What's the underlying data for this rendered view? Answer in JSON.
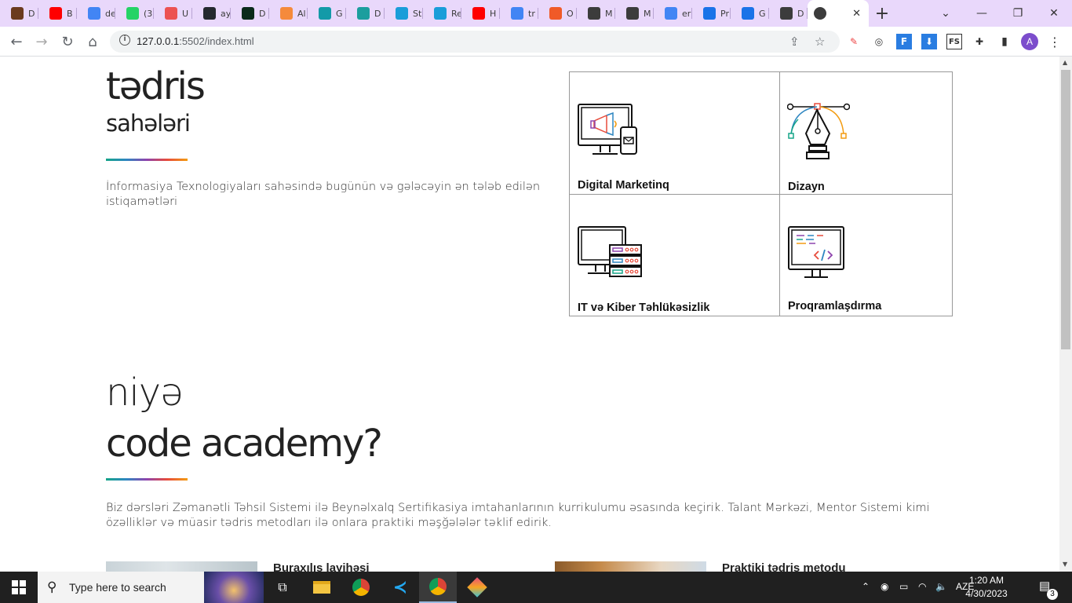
{
  "browser": {
    "tabs": [
      {
        "title": "D",
        "color": "#6b3a1e",
        "icon": "dark-favicon"
      },
      {
        "title": "B",
        "color": "#ff0000",
        "icon": "youtube-icon"
      },
      {
        "title": "de",
        "color": "#4285f4",
        "icon": "google-icon"
      },
      {
        "title": "(3",
        "color": "#25d366",
        "icon": "whatsapp-icon"
      },
      {
        "title": "U",
        "color": "#ec5252",
        "icon": "udemy-icon"
      },
      {
        "title": "ay",
        "color": "#24292e",
        "icon": "github-icon"
      },
      {
        "title": "D",
        "color": "#0a2a1a",
        "icon": "mongodb-icon"
      },
      {
        "title": "Al",
        "color": "#f58a3c",
        "icon": "heart-icon"
      },
      {
        "title": "G",
        "color": "#139aa8",
        "icon": "diamond-icon"
      },
      {
        "title": "D",
        "color": "#1c9e9e",
        "icon": "diamond-x-icon"
      },
      {
        "title": "St",
        "color": "#1a9dd9",
        "icon": "figma-dots-icon"
      },
      {
        "title": "Re",
        "color": "#1a9dd9",
        "icon": "figma-dots-icon"
      },
      {
        "title": "H",
        "color": "#ff0000",
        "icon": "youtube-icon"
      },
      {
        "title": "tr",
        "color": "#4285f4",
        "icon": "google-icon"
      },
      {
        "title": "O",
        "color": "#f05a28",
        "icon": "all-icon"
      },
      {
        "title": "M",
        "color": "#3c3c3c",
        "icon": "globe-icon"
      },
      {
        "title": "M",
        "color": "#3c3c3c",
        "icon": "globe-icon"
      },
      {
        "title": "er",
        "color": "#4285f4",
        "icon": "google-icon"
      },
      {
        "title": "Pr",
        "color": "#1a73e8",
        "icon": "c-circle-icon"
      },
      {
        "title": "G",
        "color": "#1a73e8",
        "icon": "printer-icon"
      },
      {
        "title": "D",
        "color": "#3c3c3c",
        "icon": "globe-icon"
      }
    ],
    "active_tab": {
      "title": "",
      "icon": "globe-icon",
      "close": "✕"
    },
    "new_tab": "+",
    "url_host": "127.0.0.1",
    "url_rest": ":5502/index.html",
    "avatar_letter": "A"
  },
  "section1": {
    "title_big": "tədris",
    "title_small": "sahələri",
    "lead": "İnformasiya Texnologiyaları sahəsində bugünün və gələcəyin ən tələb edilən istiqamətləri",
    "cards": [
      {
        "label": "Digital Marketinq",
        "icon": "marketing-monitor-icon"
      },
      {
        "label": "Dizayn",
        "icon": "pen-tool-icon"
      },
      {
        "label": "IT və Kiber Təhlükəsizlik",
        "icon": "server-monitor-icon"
      },
      {
        "label": "Proqramlaşdırma",
        "icon": "code-monitor-icon"
      }
    ]
  },
  "section2": {
    "title_line1": "niyə",
    "title_line2": "code academy?",
    "lead": "Biz dərsləri Zəmanətli Təhsil Sistemi ilə Beynəlxalq Sertifikasiya imtahanlarının kurrikulumu əsasında keçirik. Talant Mərkəzi, Mentor Sistemi kimi özəlliklər və müasir tədris metodları ilə onlara praktiki məşğələlər təklif edirik.",
    "features": [
      {
        "title": "Buraxılış layihəsi"
      },
      {
        "title": "Praktiki tədris metodu"
      }
    ]
  },
  "taskbar": {
    "search_placeholder": "Type here to search",
    "language": "AZE",
    "time": "1:20 AM",
    "date": "4/30/2023",
    "notifications": "3"
  }
}
